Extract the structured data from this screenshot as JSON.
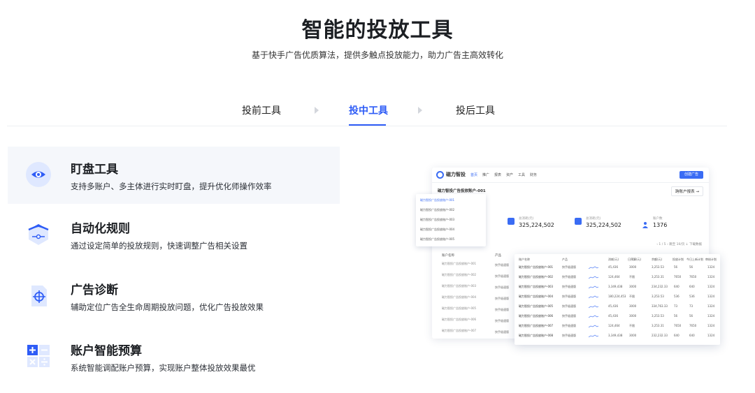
{
  "hero": {
    "title": "智能的投放工具",
    "subtitle": "基于快手广告优质算法，提供多触点投放能力，助力广告主高效转化"
  },
  "tabs": [
    {
      "label": "投前工具",
      "active": false
    },
    {
      "label": "投中工具",
      "active": true
    },
    {
      "label": "投后工具",
      "active": false
    }
  ],
  "features": [
    {
      "title": "盯盘工具",
      "desc": "支持多账户、多主体进行实时盯盘，提升优化师操作效率",
      "icon": "eye-icon",
      "active": true
    },
    {
      "title": "自动化规则",
      "desc": "通过设定简单的投放规则，快速调整广告相关设置",
      "icon": "rule-hexagon-icon",
      "active": false
    },
    {
      "title": "广告诊断",
      "desc": "辅助定位广告全生命周期投放问题，优化广告投放效果",
      "icon": "crosshair-icon",
      "active": false
    },
    {
      "title": "账户智能预算",
      "desc": "系统智能调配账户预算，实现账户整体投放效果最优",
      "icon": "calculator-icon",
      "active": false
    }
  ],
  "dashboard": {
    "brand": "磁力智投",
    "menu": [
      "首页",
      "推广",
      "报表",
      "资产",
      "工具",
      "财务"
    ],
    "create_button": "创建广告",
    "account_title": "磁力智投广告投放账户-001",
    "report_button": "跨账户报表 →",
    "dropdown_items": [
      "磁力智投广告投放账户-001",
      "磁力智投广告投放账户-002",
      "磁力智投广告投放账户-003",
      "磁力智投广告投放账户-004",
      "磁力智投广告投放账户-005"
    ],
    "stats": [
      {
        "label": "总消耗(元)",
        "value": "325,224,502"
      },
      {
        "label": "总消耗(元)",
        "value": "325,224,502"
      },
      {
        "label": "账户数",
        "value": "1376"
      }
    ],
    "pager": "‹ 1 / 5 ›   跳至  10/页  ↓ 下载数据",
    "left_table": {
      "headers": [
        "账户名称",
        "产品"
      ],
      "rows": [
        {
          "name": "磁力智投广告投放账户-001",
          "product": "快手极速版"
        },
        {
          "name": "磁力智投广告投放账户-002",
          "product": "快手极速版"
        },
        {
          "name": "磁力智投广告投放账户-003",
          "product": "快手极速版"
        },
        {
          "name": "磁力智投广告投放账户-004",
          "product": "快手极速版"
        },
        {
          "name": "磁力智投广告投放账户-005",
          "product": "快手极速版"
        },
        {
          "name": "磁力智投广告投放账户-006",
          "product": "快手极速版"
        },
        {
          "name": "磁力智投广告投放账户-007",
          "product": "快手极速版"
        }
      ]
    },
    "float_table": {
      "headers": [
        "账户名称",
        "产品",
        "消耗(元)",
        "日预算(元)",
        "余额(元)",
        "投放计划",
        "今日上新计划",
        "审核计划"
      ],
      "rows": [
        {
          "name": "磁力智投广告投放账户-001",
          "product": "快手极速版",
          "cost": "45,436",
          "budget": "3000",
          "balance": "3,253.53",
          "plans": "56",
          "new": "56",
          "review": "1324"
        },
        {
          "name": "磁力智投广告投放账户-002",
          "product": "快手极速版",
          "cost": "124,464",
          "budget": "不限",
          "balance": "3,253.31",
          "plans": "7650",
          "new": "7650",
          "review": "1324"
        },
        {
          "name": "磁力智投广告投放账户-003",
          "product": "快手极速版",
          "cost": "3,349,438",
          "budget": "3000",
          "balance": "234,232.33",
          "plans": "640",
          "new": "640",
          "review": "1324"
        },
        {
          "name": "磁力智投广告投放账户-004",
          "product": "快手极速版",
          "cost": "180,224,453",
          "budget": "不限",
          "balance": "3,253.53",
          "plans": "536",
          "new": "536",
          "review": "1324"
        },
        {
          "name": "磁力智投广告投放账户-005",
          "product": "快手极速版",
          "cost": "45,436",
          "budget": "3000",
          "balance": "334,763.33",
          "plans": "73",
          "new": "73",
          "review": "1324"
        },
        {
          "name": "磁力智投广告投放账户-006",
          "product": "快手极速版",
          "cost": "45,436",
          "budget": "3000",
          "balance": "3,253.53",
          "plans": "56",
          "new": "56",
          "review": "1324"
        },
        {
          "name": "磁力智投广告投放账户-007",
          "product": "快手极速版",
          "cost": "124,464",
          "budget": "不限",
          "balance": "3,253.31",
          "plans": "7650",
          "new": "7650",
          "review": "1324"
        },
        {
          "name": "磁力智投广告投放账户-008",
          "product": "快手极速版",
          "cost": "3,349,438",
          "budget": "3000",
          "balance": "232,232.33",
          "plans": "640",
          "new": "640",
          "review": "1324"
        }
      ]
    }
  },
  "colors": {
    "accent": "#2e5cf6",
    "icon_bg": "#dfe8ff",
    "text": "#1c1f23"
  }
}
